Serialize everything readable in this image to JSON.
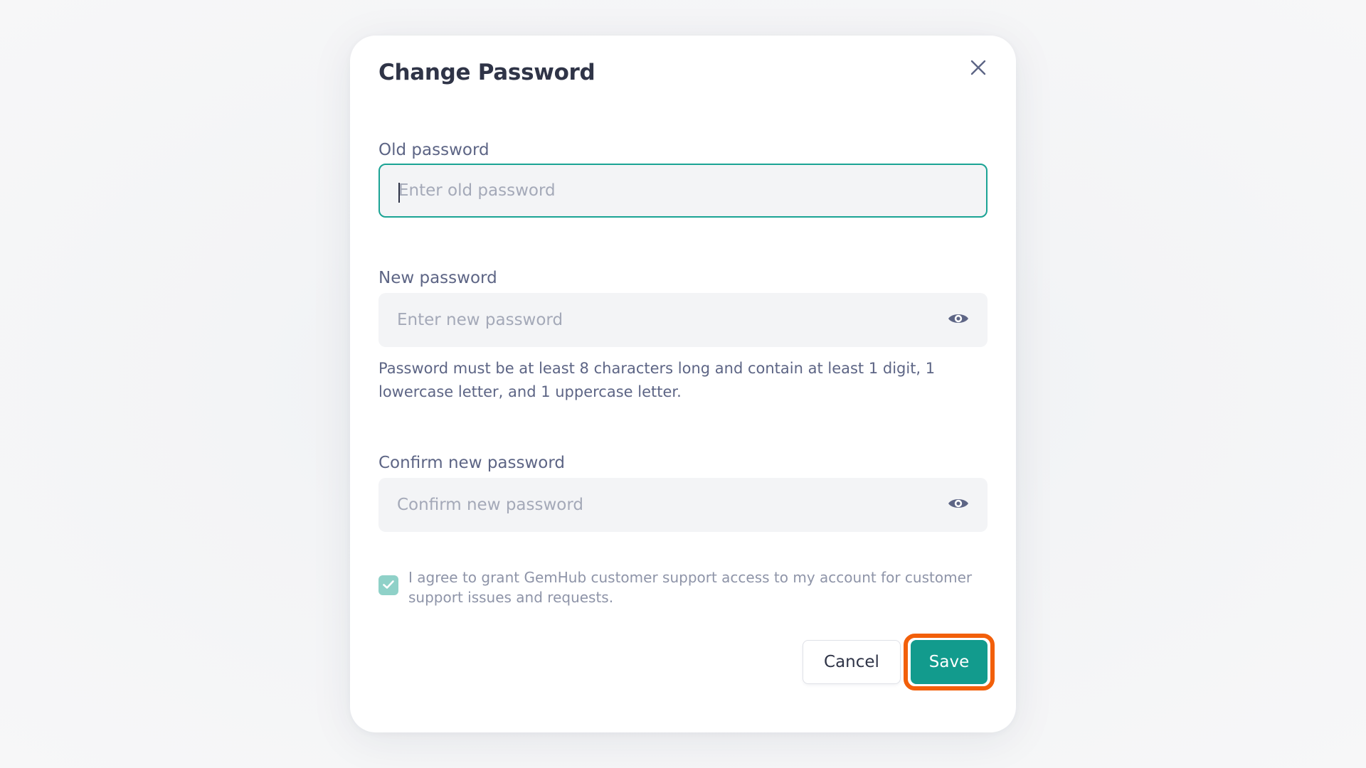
{
  "dialog": {
    "title": "Change Password",
    "close_icon": "close-icon"
  },
  "fields": {
    "old_password": {
      "label": "Old password",
      "placeholder": "Enter old password",
      "value": ""
    },
    "new_password": {
      "label": "New password",
      "placeholder": "Enter new password",
      "value": "",
      "toggle_icon": "eye-icon"
    },
    "confirm_password": {
      "label": "Confirm new password",
      "placeholder": "Confirm new password",
      "value": "",
      "toggle_icon": "eye-icon"
    }
  },
  "hint": "Password must be at least 8 characters long and contain at least 1 digit, 1 lowercase letter, and 1 uppercase letter.",
  "consent": {
    "checked": true,
    "text": "I agree to grant GemHub customer support access to my account for customer support issues and requests."
  },
  "actions": {
    "cancel_label": "Cancel",
    "save_label": "Save"
  },
  "colors": {
    "accent": "#129b8d",
    "focus_border": "#1aa394",
    "highlight": "#f25f0a",
    "title_text": "#2f3447",
    "label_text": "#5d6585",
    "placeholder_text": "#a4a9b8",
    "checkbox_fill": "#8fd1c8"
  }
}
